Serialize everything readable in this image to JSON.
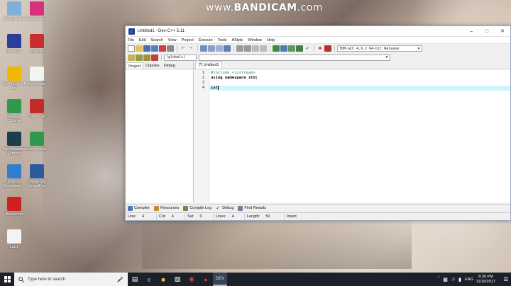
{
  "watermark": {
    "prefix": "www.",
    "brand": "BANDICAM",
    "suffix": ".com"
  },
  "desktop_icons": [
    {
      "label": "Recycle Bin",
      "icon": "recycle-bin-icon",
      "color": "#7fb0d8"
    },
    {
      "label": "Wamphere...",
      "icon": "wamp-icon",
      "color": "#d6317c"
    },
    {
      "label": "Dev-C++",
      "icon": "dev-cpp-icon",
      "color": "#2a3f9c"
    },
    {
      "label": "Selector",
      "icon": "scissors-icon",
      "color": "#c83030"
    },
    {
      "label": "PotPlayer 64 bit",
      "icon": "potplayer-icon",
      "color": "#f0b800"
    },
    {
      "label": "New folder",
      "icon": "document-icon",
      "color": "#f3f3f3"
    },
    {
      "label": "Google Chrome",
      "icon": "chrome-icon",
      "color": "#2f9a4c"
    },
    {
      "label": "Slide note",
      "icon": "pdf-icon",
      "color": "#c42a2a"
    },
    {
      "label": "Wondershare Filmora",
      "icon": "filmora-icon",
      "color": "#1c3d4e"
    },
    {
      "label": "pre.english",
      "icon": "chrome-icon",
      "color": "#2f9a4c"
    },
    {
      "label": "Internet Download...",
      "icon": "idm-icon",
      "color": "#2f7fd0"
    },
    {
      "label": "Oracle VM VirtualBox",
      "icon": "virtualbox-icon",
      "color": "#2c5a9a"
    },
    {
      "label": "Bandicam",
      "icon": "bandicam-icon",
      "color": "#d02020"
    },
    {
      "label": "Lab1",
      "icon": "file-icon",
      "color": "#f3f3f3"
    }
  ],
  "window": {
    "title": "Untitled1 - Dev-C++ 5.11",
    "menu": [
      "File",
      "Edit",
      "Search",
      "View",
      "Project",
      "Execute",
      "Tools",
      "AStyle",
      "Window",
      "Help"
    ],
    "compiler_select": "TDM-GCC 4.9.2 64-bit Release",
    "scope_select": "(globals)",
    "left_tabs": [
      "Project",
      "Classes",
      "Debug"
    ],
    "editor_tab": "[*] Untitled1",
    "line_numbers": [
      "1",
      "2",
      "3",
      "4"
    ],
    "code_lines": [
      "#include <iostream>",
      "using namespace std;",
      "",
      "int"
    ],
    "bottom_tabs": [
      "Compiler",
      "Resources",
      "Compile Log",
      "Debug",
      "Find Results"
    ],
    "status": {
      "line_label": "Line:",
      "line": "4",
      "col_label": "Col:",
      "col": "4",
      "sel_label": "Sel:",
      "sel": "0",
      "lines_label": "Lines:",
      "lines": "4",
      "length_label": "Length:",
      "length": "50",
      "mode": "Insert"
    }
  },
  "taskbar": {
    "search_placeholder": "Type here to search",
    "language": "ENG",
    "time": "8:30 PM",
    "date": "11/16/2017"
  }
}
